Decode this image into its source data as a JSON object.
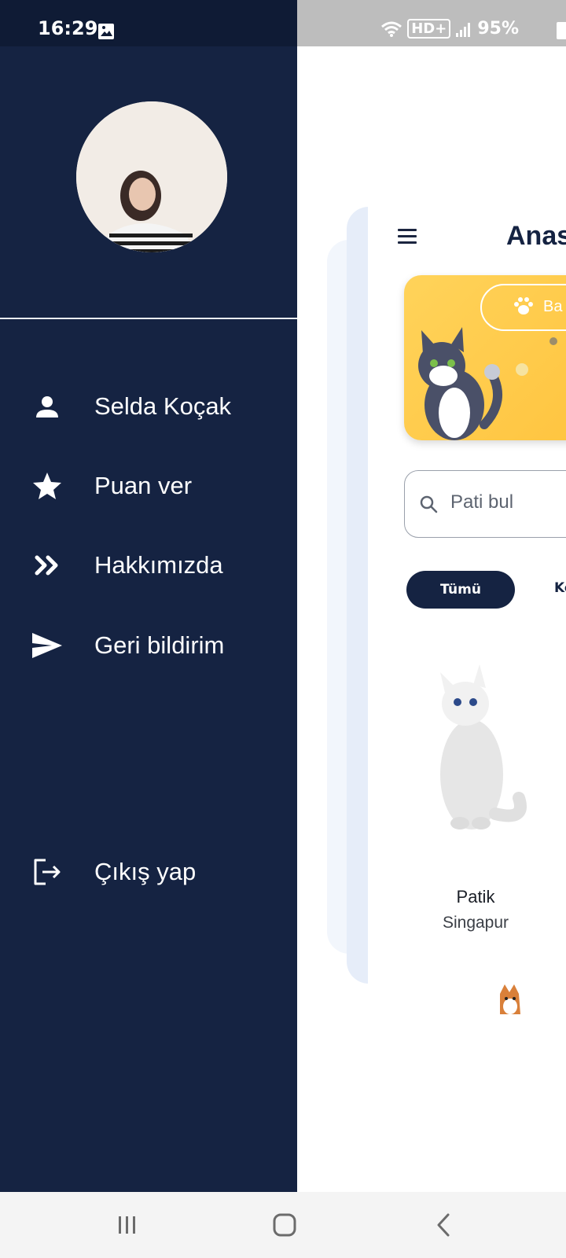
{
  "status_bar": {
    "time": "16:29",
    "network_label": "HD+",
    "battery": "95%",
    "icons": [
      "gallery-icon",
      "wifi-icon",
      "signal-icon",
      "battery-icon"
    ]
  },
  "drawer": {
    "background": "#152342",
    "menu": [
      {
        "label": "Selda Koçak",
        "icon": "person-icon"
      },
      {
        "label": "Puan ver",
        "icon": "star-icon"
      },
      {
        "label": "Hakkımızda",
        "icon": "double-chevron-icon"
      },
      {
        "label": "Geri bildirim",
        "icon": "send-icon"
      }
    ],
    "logout": {
      "label": "Çıkış yap",
      "icon": "logout-icon"
    }
  },
  "main": {
    "title": "Anas",
    "banner_button_label": "Ba",
    "search_placeholder": "Pati bul",
    "filters": {
      "active": "Tümü",
      "next_partial": "Ke"
    },
    "pet": {
      "name": "Patik",
      "location": "Singapur"
    }
  },
  "nav_bar": {
    "icons": [
      "recents-icon",
      "home-icon",
      "back-icon"
    ]
  },
  "colors": {
    "accent_dark": "#152342",
    "banner_yellow": "#ffd35a"
  }
}
